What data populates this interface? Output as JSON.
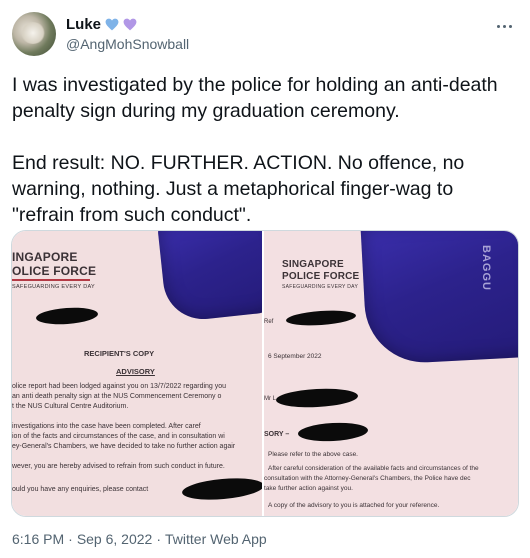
{
  "author": {
    "display_name": "Luke",
    "handle": "@AngMohSnowball",
    "heart_colors": [
      "#7fb3e8",
      "#b197e6"
    ]
  },
  "icons": {
    "more": "more-horizontal-icon",
    "hearts": [
      "blue-heart-icon",
      "purple-heart-icon"
    ]
  },
  "tweet": {
    "paragraph_1": "I was investigated by the police for holding an anti-death penalty sign during my graduation ceremony.",
    "paragraph_2": "End result: NO. FURTHER. ACTION. No offence, no warning, nothing. Just a metaphorical finger-wag to \"refrain from such conduct\"."
  },
  "media": {
    "left_photo": {
      "org_line1": "INGAPORE",
      "org_line2": "OLICE FORCE",
      "tagline": "SAFEGUARDING EVERY DAY",
      "copy_label": "RECIPIENT'S COPY",
      "heading": "ADVISORY",
      "line1": "olice report had been lodged against you on 13/7/2022 regarding you",
      "line2": "an anti death penalty sign at the NUS Commencement Ceremony o",
      "line3": "t the NUS Cultural Centre Auditorium.",
      "line4": "investigations into the case have been completed. After caref",
      "line5": "ion of the facts and circumstances of the case, and in consultation wi",
      "line6": "ey-General's Chambers, we have decided to take no further action agair",
      "line7": "wever, you are hereby advised to refrain from such conduct in future.",
      "line8": "ould you have any enquiries, please contact"
    },
    "right_photo": {
      "org_line1": "SINGAPORE",
      "org_line2": "POLICE FORCE",
      "tagline": "SAFEGUARDING EVERY DAY",
      "bag_label": "BAGGU",
      "ref": "Ref",
      "date": "6 September 2022",
      "mr": "Mr L",
      "sory": "SORY –",
      "refer": "Please refer to the above case.",
      "p1": "After careful consideration of the available facts and circumstances of the",
      "p2": "consultation with the Attorney-General's Chambers, the Police have dec",
      "p3": "take further action against you.",
      "p4": "A copy of the advisory to you is attached for your reference."
    }
  },
  "meta": {
    "time": "6:16 PM",
    "separator": "·",
    "date": "Sep 6, 2022",
    "source": "Twitter Web App"
  }
}
